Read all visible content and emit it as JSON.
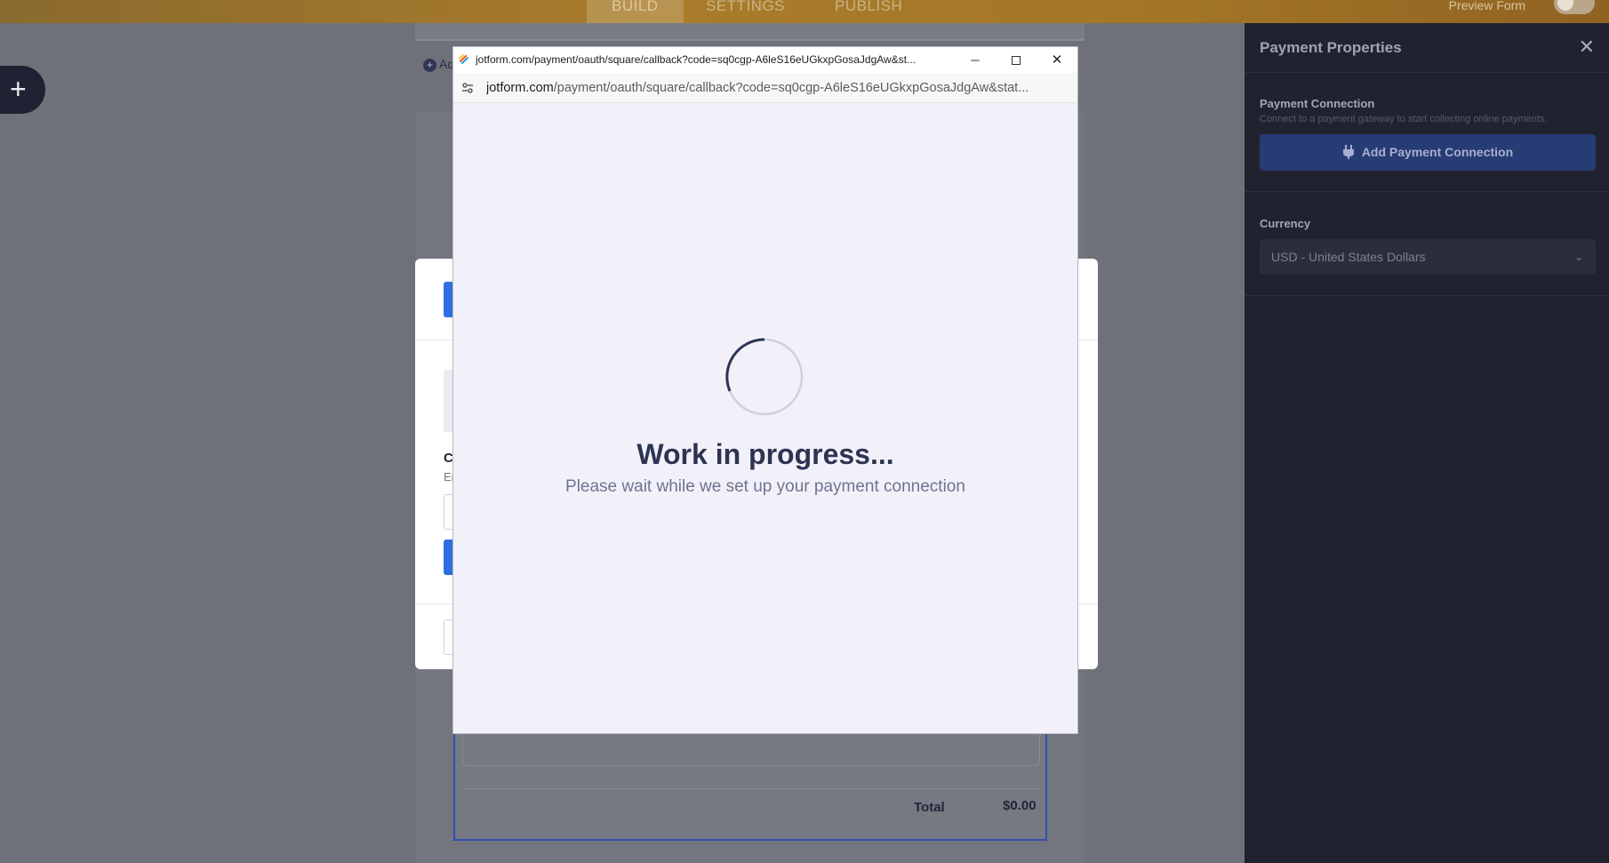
{
  "topbar": {
    "tabs": [
      {
        "label": "BUILD",
        "active": true
      },
      {
        "label": "SETTINGS",
        "active": false
      },
      {
        "label": "PUBLISH",
        "active": false
      }
    ],
    "preview_label": "Preview Form"
  },
  "left": {
    "add_button": "+"
  },
  "form": {
    "add_element_label": "Ad",
    "total_label": "Total",
    "total_value": "$0.00"
  },
  "modal": {
    "c_letter": "C",
    "e_letter": "Er"
  },
  "right_panel": {
    "title": "Payment Properties",
    "close_icon": "close-icon",
    "payment_connection": {
      "title": "Payment Connection",
      "description": "Connect to a payment gateway to start collecting online payments.",
      "button_label": "Add Payment Connection",
      "button_icon": "plug-icon"
    },
    "currency": {
      "title": "Currency",
      "selected": "USD - United States Dollars"
    }
  },
  "popup": {
    "window_title": "jotform.com/payment/oauth/square/callback?code=sq0cgp-A6leS16eUGkxpGosaJdgAw&st...",
    "url_host": "jotform.com",
    "url_path": "/payment/oauth/square/callback?code=sq0cgp-A6leS16eUGkxpGosaJdgAw&stat...",
    "heading": "Work in progress...",
    "subheading": "Please wait while we set up your payment connection"
  },
  "colors": {
    "brand_orange": "#a97c2b",
    "accent_blue": "#2f6fe0",
    "panel_dark": "#20232f",
    "heading_navy": "#2c3452"
  }
}
